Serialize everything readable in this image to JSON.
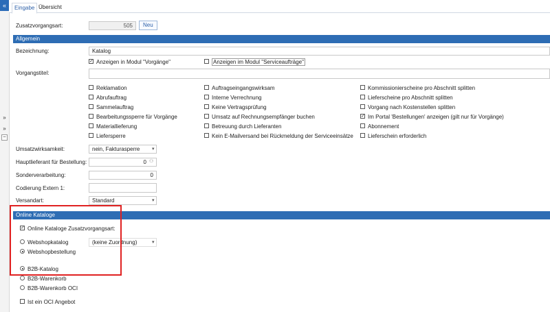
{
  "left_strip": {
    "top_icon": "«",
    "icons": [
      "double-chevron-down-icon",
      "double-chevron-up-icon",
      "minus-icon"
    ],
    "glyphs": [
      "»",
      "»",
      "−"
    ]
  },
  "tabs": [
    {
      "label": "Eingabe"
    },
    {
      "label": "Übersicht"
    }
  ],
  "zusatz": {
    "label": "Zusatzvorgangsart:",
    "value": "505",
    "button": "Neu"
  },
  "allgemein": {
    "title": "Allgemein",
    "bezeichnung_label": "Bezeichnung:",
    "bezeichnung_value": "Katalog",
    "cb_modul_vorgaenge": "Anzeigen in Modul \"Vorgänge\"",
    "cb_modul_service": "Anzeigen im Modul \"Serviceaufträge\"",
    "vorgangstitel_label": "Vorgangstitel:",
    "checks_col1": [
      "Reklamation",
      "Abrufauftrag",
      "Sammelauftrag",
      "Bearbeitungssperre für Vorgänge",
      "Materiallieferung",
      "Liefersperre"
    ],
    "checks_col2": [
      "Auftragseingangswirksam",
      "Interne Verrechnung",
      "Keine Vertragsprüfung",
      "Umsatz auf Rechnungsempfänger buchen",
      "Betreuung durch Lieferanten",
      "Kein E-Mailversand bei Rückmeldung der Serviceeinsätze"
    ],
    "checks_col3": [
      "Kommissionierscheine pro Abschnitt splitten",
      "Lieferscheine pro Abschnitt splitten",
      "Vorgang nach Kostenstellen splitten",
      "Im Portal 'Bestellungen' anzeigen (gilt nur für Vorgänge)",
      "Abonnement",
      "Lieferschein erforderlich"
    ],
    "checked_col3": [
      false,
      false,
      false,
      true,
      false,
      false
    ],
    "umsatz_label": "Umsatzwirksamkeit:",
    "umsatz_value": "nein, Fakturasperre",
    "hauptlieferant_label": "Hauptlieferant für Bestellung:",
    "hauptlieferant_value": "0",
    "sonder_label": "Sonderverarbeitung:",
    "sonder_value": "0",
    "codierung_label": "Codierung Extern 1:",
    "codierung_value": "",
    "versandart_label": "Versandart:",
    "versandart_value": "Standard"
  },
  "online": {
    "title": "Online Kataloge",
    "cb_label": "Online Kataloge Zusatzvorgangsart:",
    "radio1": "Webshopkatalog",
    "radio1_select": "(keine Zuordnung)",
    "radio2": "Webshopbestellung",
    "radio3": "B2B-Katalog",
    "radio4": "B2B-Warenkorb",
    "radio5": "B2B-Warenkorb OCI",
    "cb_oci": "Ist ein OCI Angebot"
  },
  "colors": {
    "accent": "#2e6db4",
    "highlight": "#e02020"
  }
}
